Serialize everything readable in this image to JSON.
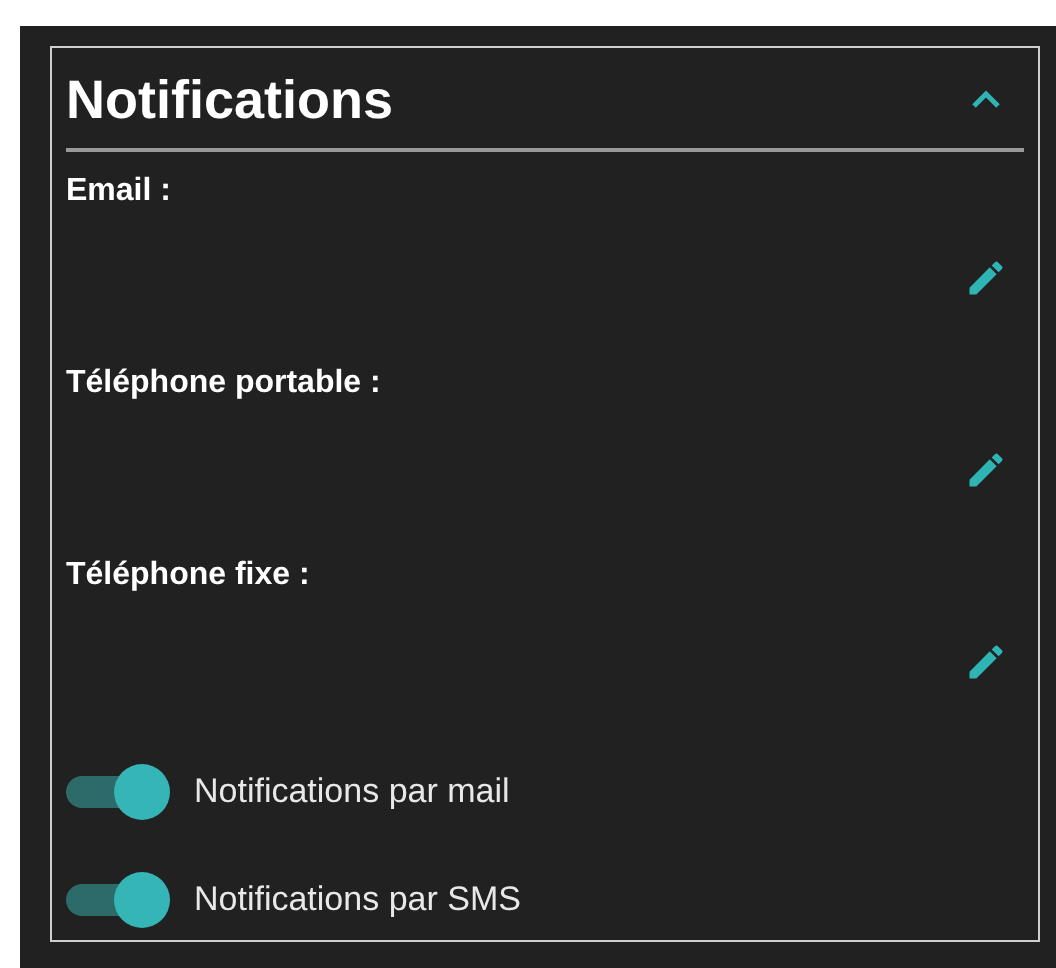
{
  "section": {
    "title": "Notifications",
    "expanded": true
  },
  "fields": [
    {
      "label": "Email :"
    },
    {
      "label": "Téléphone portable :"
    },
    {
      "label": "Téléphone fixe :"
    }
  ],
  "toggles": [
    {
      "label": "Notifications par mail",
      "on": true
    },
    {
      "label": "Notifications par SMS",
      "on": true
    }
  ]
}
